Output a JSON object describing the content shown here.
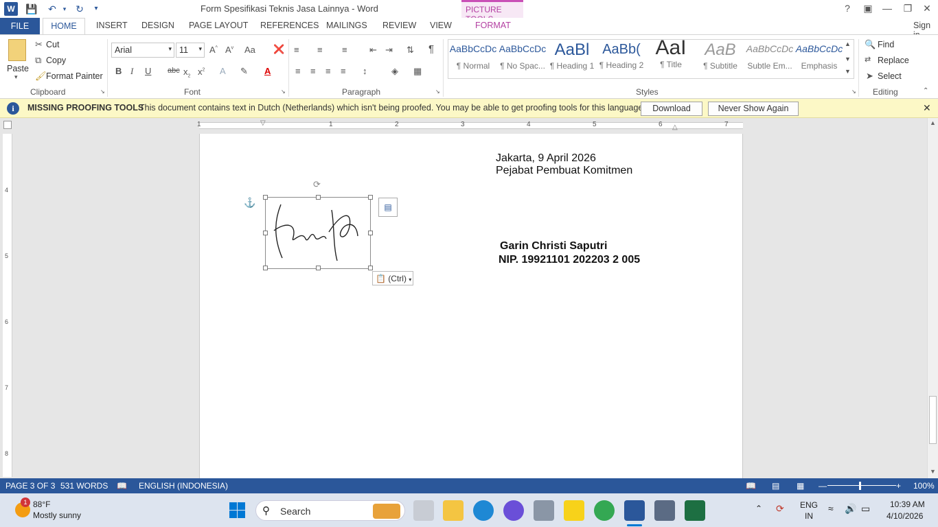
{
  "window": {
    "title": "Form Spesifikasi Teknis Jasa Lainnya - Word",
    "picture_tools": "PICTURE TOOLS",
    "help": "?",
    "sign_in": "Sign in"
  },
  "tabs": [
    "FILE",
    "HOME",
    "INSERT",
    "DESIGN",
    "PAGE LAYOUT",
    "REFERENCES",
    "MAILINGS",
    "REVIEW",
    "VIEW",
    "FORMAT"
  ],
  "ribbon": {
    "clipboard": {
      "paste": "Paste",
      "cut": "Cut",
      "copy": "Copy",
      "format_painter": "Format Painter",
      "label": "Clipboard"
    },
    "font": {
      "name": "Arial",
      "size": "11",
      "label": "Font"
    },
    "paragraph": {
      "label": "Paragraph"
    },
    "styles": {
      "label": "Styles",
      "items": [
        {
          "preview": "AaBbCcDc",
          "name": "¶ Normal"
        },
        {
          "preview": "AaBbCcDc",
          "name": "¶ No Spac..."
        },
        {
          "preview": "AaBl",
          "name": "¶ Heading 1"
        },
        {
          "preview": "AaBb(",
          "name": "¶ Heading 2"
        },
        {
          "preview": "AaI",
          "name": "¶ Title"
        },
        {
          "preview": "AaB",
          "name": "¶ Subtitle"
        },
        {
          "preview": "AaBbCcDc",
          "name": "Subtle Em..."
        },
        {
          "preview": "AaBbCcDc",
          "name": "Emphasis"
        }
      ]
    },
    "editing": {
      "find": "Find",
      "replace": "Replace",
      "select": "Select",
      "label": "Editing"
    }
  },
  "infobar": {
    "title": "MISSING PROOFING TOOLS",
    "message": "This document contains text in Dutch (Netherlands) which isn't being proofed. You may be able to get proofing tools for this language.",
    "download": "Download",
    "never_show": "Never Show Again"
  },
  "ruler": {
    "numbers": [
      "1",
      "1",
      "2",
      "3",
      "4",
      "5",
      "6",
      "7"
    ]
  },
  "vruler": {
    "numbers": [
      "4",
      "5",
      "6",
      "7",
      "8"
    ]
  },
  "document": {
    "date_line": "Jakarta, 9 April 2026",
    "role_line": "Pejabat Pembuat Komitmen",
    "name": "Garin Christi Saputri",
    "nip": "NIP. 19921101 202203 2 005",
    "paste_options": "(Ctrl)"
  },
  "status": {
    "page": "PAGE 3 OF 3",
    "words": "531 WORDS",
    "language": "ENGLISH (INDONESIA)",
    "zoom": "100%"
  },
  "taskbar": {
    "weather_temp": "88°F",
    "weather_desc": "Mostly sunny",
    "weather_badge": "1",
    "search": "Search",
    "lang_top": "ENG",
    "lang_bottom": "IN",
    "time": "10:39 AM",
    "date": "4/10/2026"
  },
  "colors": {
    "word_blue": "#2b579a",
    "picture_tools": "#b33ea1",
    "infobar": "#fcf8c6"
  }
}
